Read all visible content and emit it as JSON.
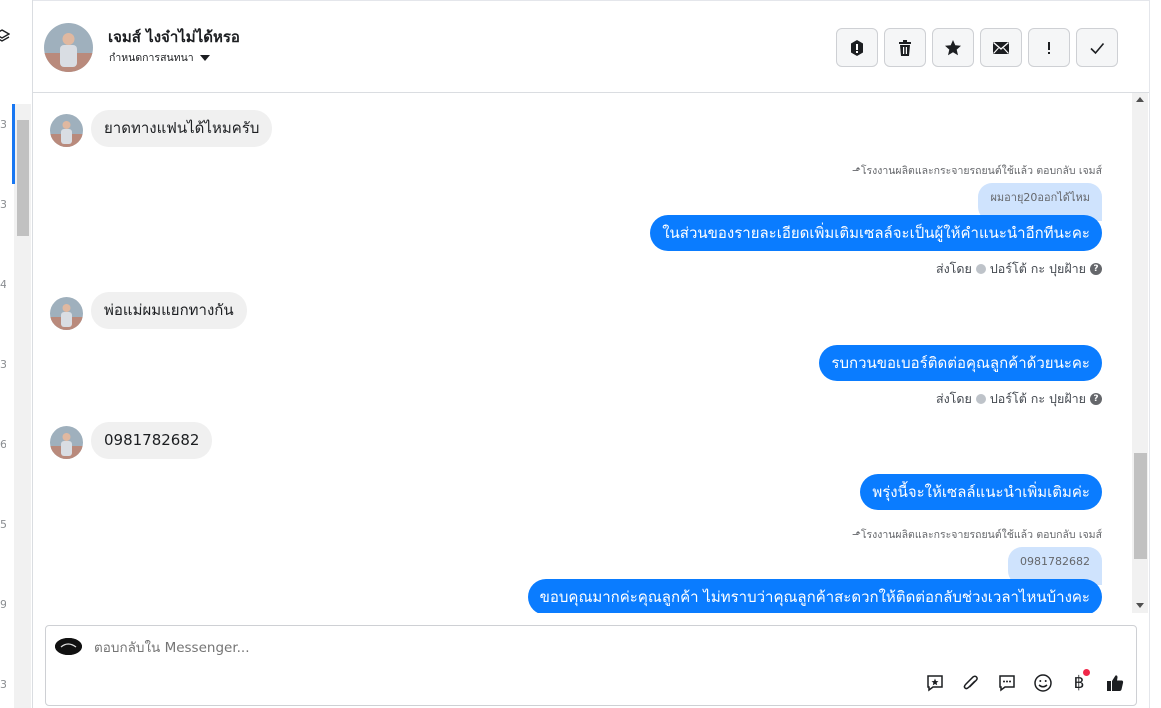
{
  "sidebar": {
    "numbers": [
      "3",
      "3",
      "4",
      "3",
      "6",
      "5",
      "9",
      "3"
    ]
  },
  "header": {
    "contact_name": "เจมส์ ไงจ๋าไม่ได้หรอ",
    "subtitle": "กำหนดการสนทนา",
    "actions": [
      {
        "name": "spam-report-button",
        "icon": "exclamation-circle-icon"
      },
      {
        "name": "delete-button",
        "icon": "trash-icon"
      },
      {
        "name": "star-button",
        "icon": "star-icon"
      },
      {
        "name": "mark-unread-button",
        "icon": "envelope-icon"
      },
      {
        "name": "follow-up-button",
        "icon": "exclamation-icon"
      },
      {
        "name": "mark-done-button",
        "icon": "check-icon"
      }
    ]
  },
  "messages": {
    "m1": {
      "text": "ยาดทางแฟนได้ไหมครับ"
    },
    "m2": {
      "reply_note": "โรงงานผลิตและกระจายรถยนต์ใช้แล้ว ตอบกลับ เจมส์",
      "quoted": "ผมอายุ20ออกได้ไหม",
      "text": "ในส่วนของรายละเอียดเพิ่มเติมเซลล์จะเป็นผู้ให้คำแนะนำอีกทีนะคะ",
      "sent_by_prefix": "ส่งโดย",
      "sent_by_name": "ปอร์โต้ กะ ปุยฝ้าย"
    },
    "m3": {
      "text": "พ่อแม่ผมแยกทางกัน"
    },
    "m4": {
      "text": "รบกวนขอเบอร์ติดต่อคุณลูกค้าด้วยนะคะ",
      "sent_by_prefix": "ส่งโดย",
      "sent_by_name": "ปอร์โต้ กะ ปุยฝ้าย"
    },
    "m5": {
      "text": "0981782682"
    },
    "m6": {
      "text": "พรุ่งนี้จะให้เซลล์แนะนำเพิ่มเติมค่ะ"
    },
    "m7": {
      "reply_note": "โรงงานผลิตและกระจายรถยนต์ใช้แล้ว ตอบกลับ เจมส์",
      "quoted": "0981782682",
      "text": "ขอบคุณมากค่ะคุณลูกค้า ไม่ทราบว่าคุณลูกค้าสะดวกให้ติดต่อกลับช่วงเวลาไหนบ้างคะ"
    }
  },
  "composer": {
    "placeholder": "ตอบกลับใน Messenger...",
    "baht_symbol": "฿",
    "tools": [
      "saved-reply-icon",
      "paperclip-icon",
      "chat-bubble-icon",
      "emoji-icon",
      "baht-icon",
      "thumbs-up-icon"
    ]
  },
  "colors": {
    "accent": "#0a7cff",
    "incoming_bubble": "#f0f0f0",
    "quoted_bubble": "#cfe3fd"
  }
}
